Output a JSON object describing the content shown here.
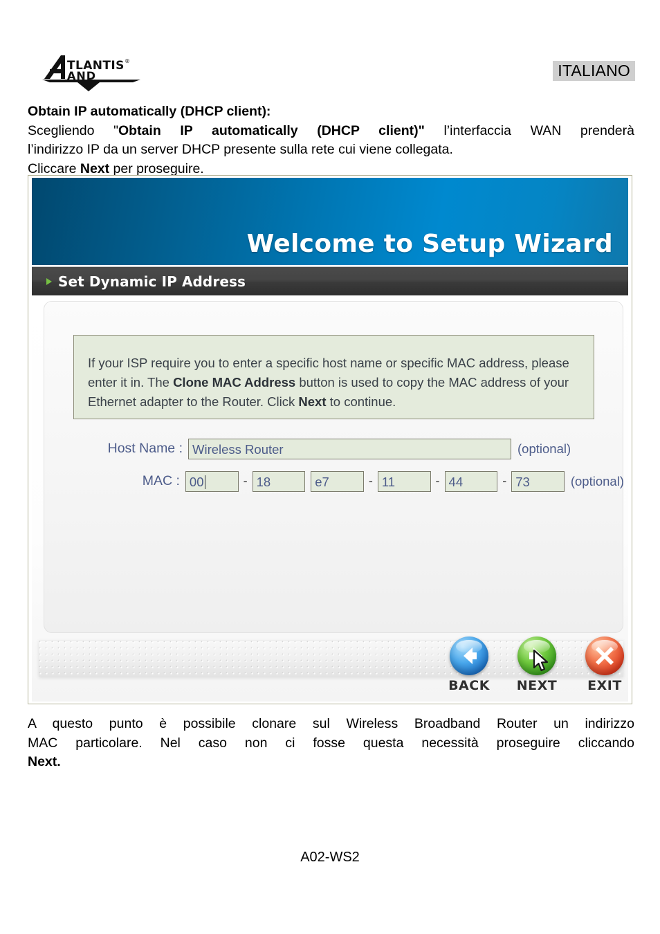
{
  "header": {
    "logo_primary": "ATLANTIS",
    "logo_registered": "®",
    "logo_secondary": "LAND",
    "language_badge": "ITALIANO"
  },
  "intro": {
    "heading": "Obtain IP automatically (DHCP client):",
    "line1_a": "Scegliendo \"",
    "line1_b": "Obtain IP automatically (DHCP client)\"",
    "line1_c": " l’interfaccia WAN prenderà",
    "line2": "l’indirizzo IP da un server DHCP presente sulla rete cui viene collegata.",
    "line3_a": "Cliccare ",
    "line3_b": "Next",
    "line3_c": " per proseguire."
  },
  "wizard": {
    "banner_title": "Welcome to Setup Wizard",
    "section_title": "Set Dynamic IP Address",
    "notice": {
      "part1": "If your ISP require you to enter a specific host name or specific MAC address, please enter it in. The ",
      "bold1": "Clone MAC Address",
      "part2": " button is used to copy the MAC address of your Ethernet adapter to the Router. Click ",
      "bold2": "Next",
      "part3": " to continue."
    },
    "host_name": {
      "label": "Host Name :",
      "value": "Wireless Router",
      "optional": "(optional)"
    },
    "mac": {
      "label": "MAC :",
      "octets": [
        "00",
        "18",
        "e7",
        "11",
        "44",
        "73"
      ],
      "separator": "-",
      "optional": "(optional)"
    },
    "buttons": [
      {
        "label": "BACK",
        "icon": "arrow-left-icon",
        "color": "#1b6fc4"
      },
      {
        "label": "NEXT",
        "icon": "arrow-right-icon",
        "color": "#35991c"
      },
      {
        "label": "EXIT",
        "icon": "close-x-icon",
        "color": "#d9371c"
      }
    ]
  },
  "outro": {
    "line1": "A questo punto è possibile clonare sul Wireless Broadband Router un indirizzo",
    "line2": "MAC particolare. Nel caso non ci fosse questa necessità proseguire cliccando",
    "line3": "Next."
  },
  "footer": {
    "code": "A02-WS2"
  }
}
